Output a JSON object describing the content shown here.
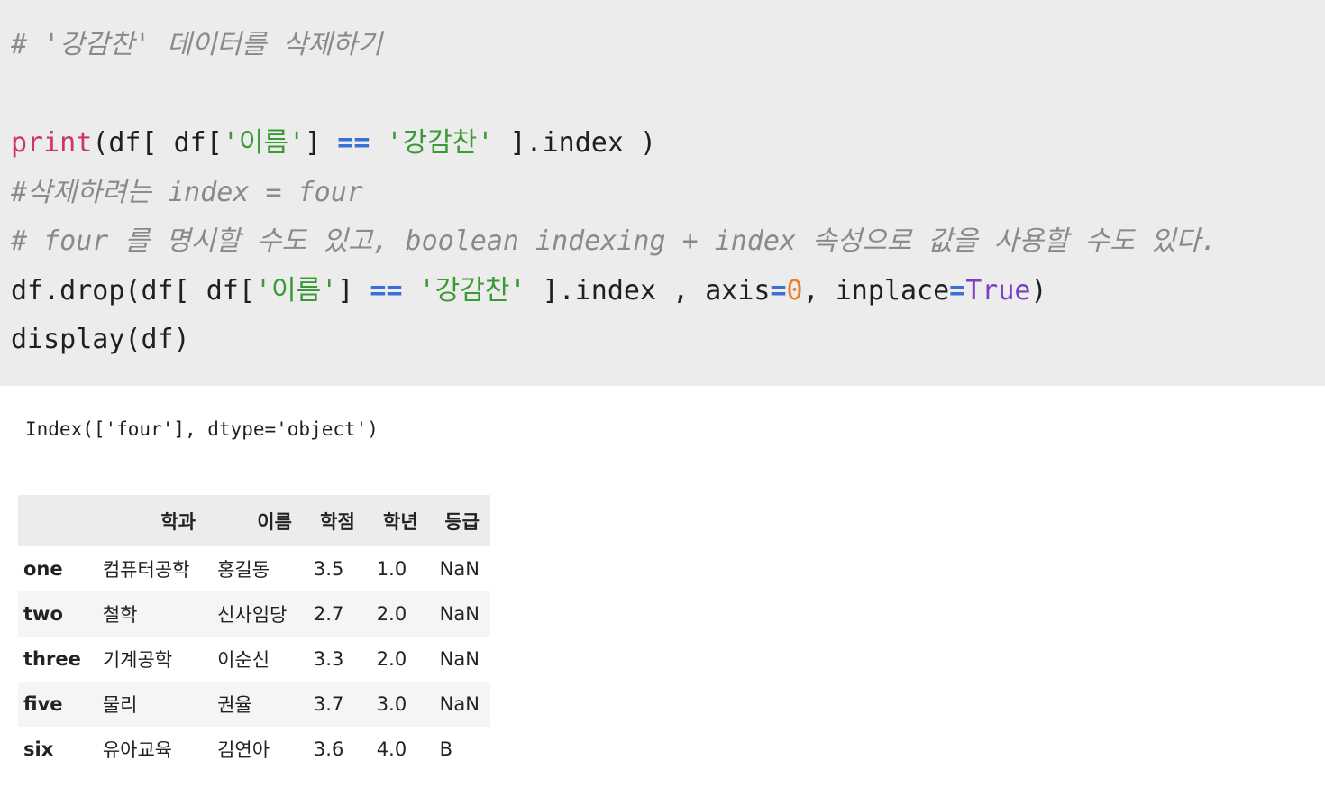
{
  "code": {
    "line1_comment": "# '강감찬' 데이터를 삭제하기",
    "line2": {
      "fn": "print",
      "a": "(df[ df[",
      "s1": "'이름'",
      "b": "] ",
      "op": "==",
      "c": " ",
      "s2": "'강감찬'",
      "d": " ].index )"
    },
    "line3_comment": "#삭제하려는 index = four",
    "line4_comment": "# four 를 명시할 수도 있고, boolean indexing + index 속성으로 값을 사용할 수도 있다.",
    "line5": {
      "a": "df.drop(df[ df[",
      "s1": "'이름'",
      "b": "] ",
      "op": "==",
      "c": " ",
      "s2": "'강감찬'",
      "d": " ].index , axis",
      "eq1": "=",
      "num": "0",
      "e": ", inplace",
      "eq2": "=",
      "bool": "True",
      "f": ")"
    },
    "line6": "display(df)"
  },
  "output": {
    "print_result": "Index(['four'], dtype='object')"
  },
  "dataframe": {
    "columns": [
      "",
      "학과",
      "이름",
      "학점",
      "학년",
      "등급"
    ],
    "rows": [
      {
        "index": "one",
        "dept": "컴퓨터공학",
        "name": "홍길동",
        "score": "3.5",
        "year": "1.0",
        "grade": "NaN"
      },
      {
        "index": "two",
        "dept": "철학",
        "name": "신사임당",
        "score": "2.7",
        "year": "2.0",
        "grade": "NaN"
      },
      {
        "index": "three",
        "dept": "기계공학",
        "name": "이순신",
        "score": "3.3",
        "year": "2.0",
        "grade": "NaN"
      },
      {
        "index": "five",
        "dept": "물리",
        "name": "권율",
        "score": "3.7",
        "year": "3.0",
        "grade": "NaN"
      },
      {
        "index": "six",
        "dept": "유아교육",
        "name": "김연아",
        "score": "3.6",
        "year": "4.0",
        "grade": "B"
      }
    ]
  }
}
